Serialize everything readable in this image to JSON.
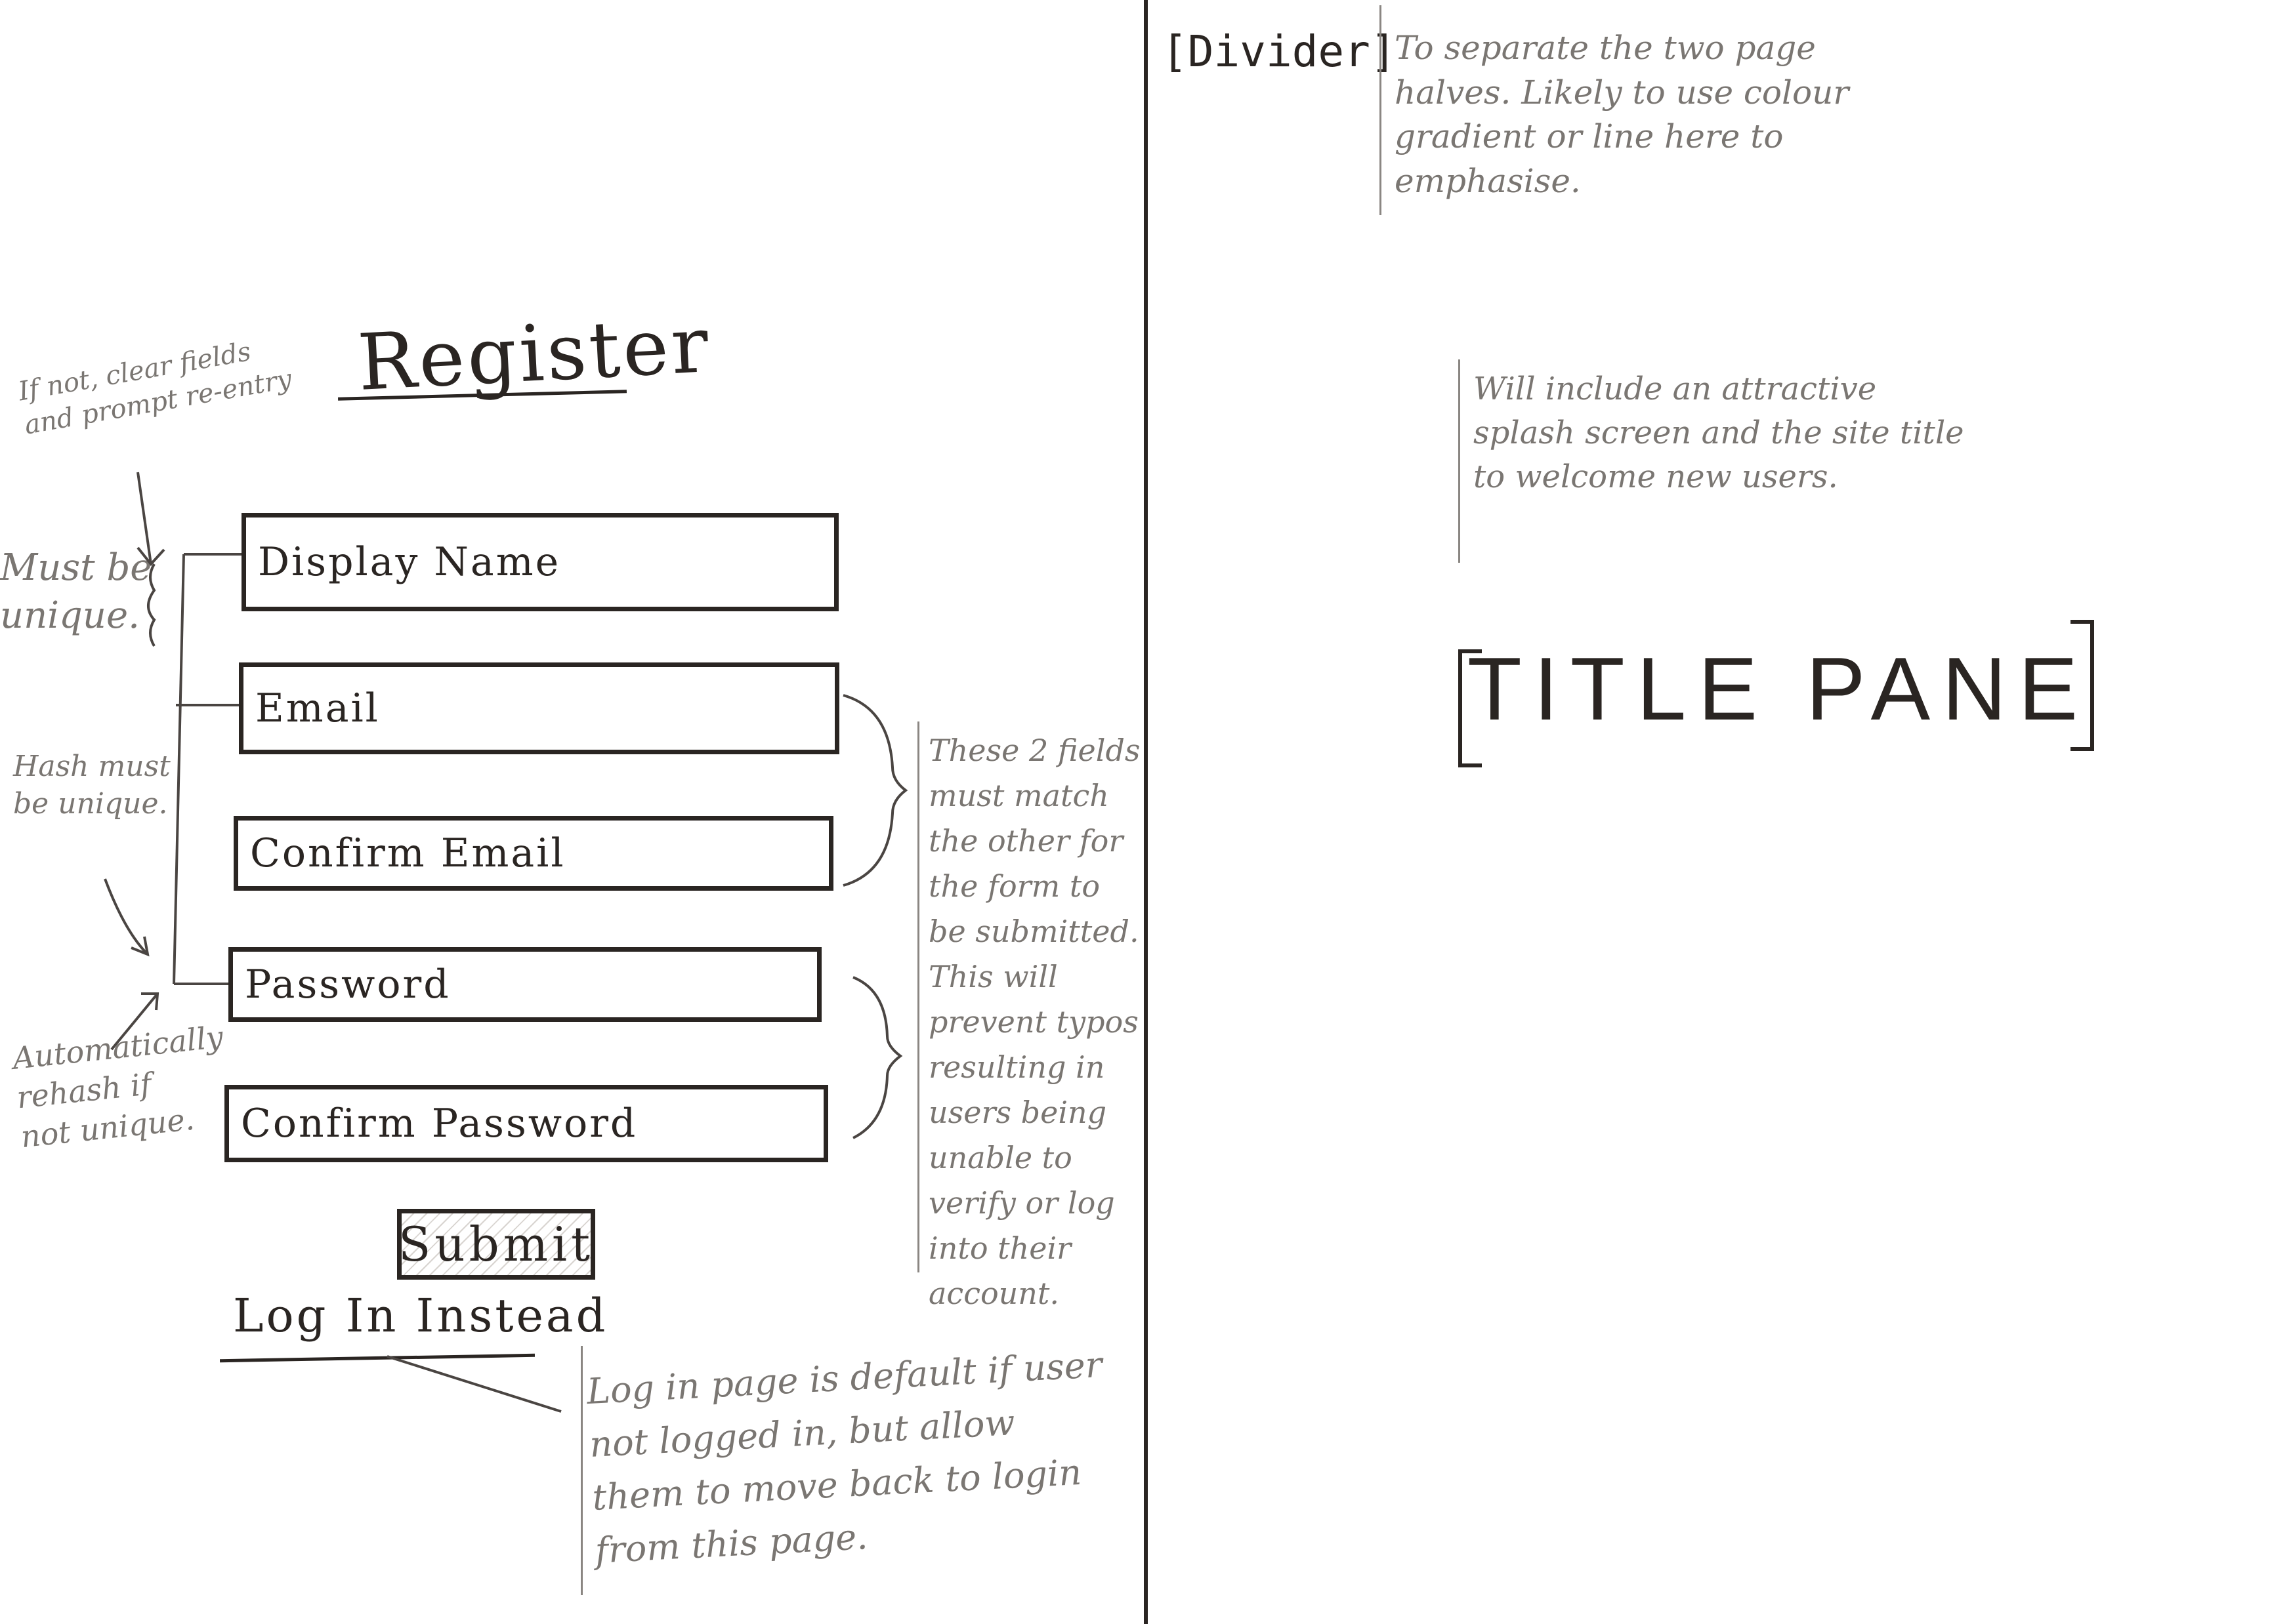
{
  "register": {
    "title": "Register",
    "fields": [
      {
        "label": "Display Name"
      },
      {
        "label": "Email"
      },
      {
        "label": "Confirm Email"
      },
      {
        "label": "Password"
      },
      {
        "label": "Confirm Password"
      }
    ],
    "submit_label": "Submit",
    "login_link": "Log In Instead"
  },
  "right": {
    "divider_tag": "[Divider]",
    "divider_note": "To separate the two page halves. Likely to use colour gradient or line here to emphasise.",
    "splash_note": "Will include an attractive splash screen and the site title to welcome new users.",
    "title_pane": "TITLE PANE"
  },
  "notes": {
    "clear_fields": "If not, clear fields and prompt re-entry",
    "must_unique": "Must be unique.",
    "hash_unique": "Hash must be unique.",
    "rehash": "Automatically rehash if not unique.",
    "match": "These 2 fields must match the other for the form to be submitted. This will prevent typos resulting in users being unable to verify or log into their account.",
    "login": "Log in page is default if user not logged in, but allow them to move back to login from this page."
  }
}
